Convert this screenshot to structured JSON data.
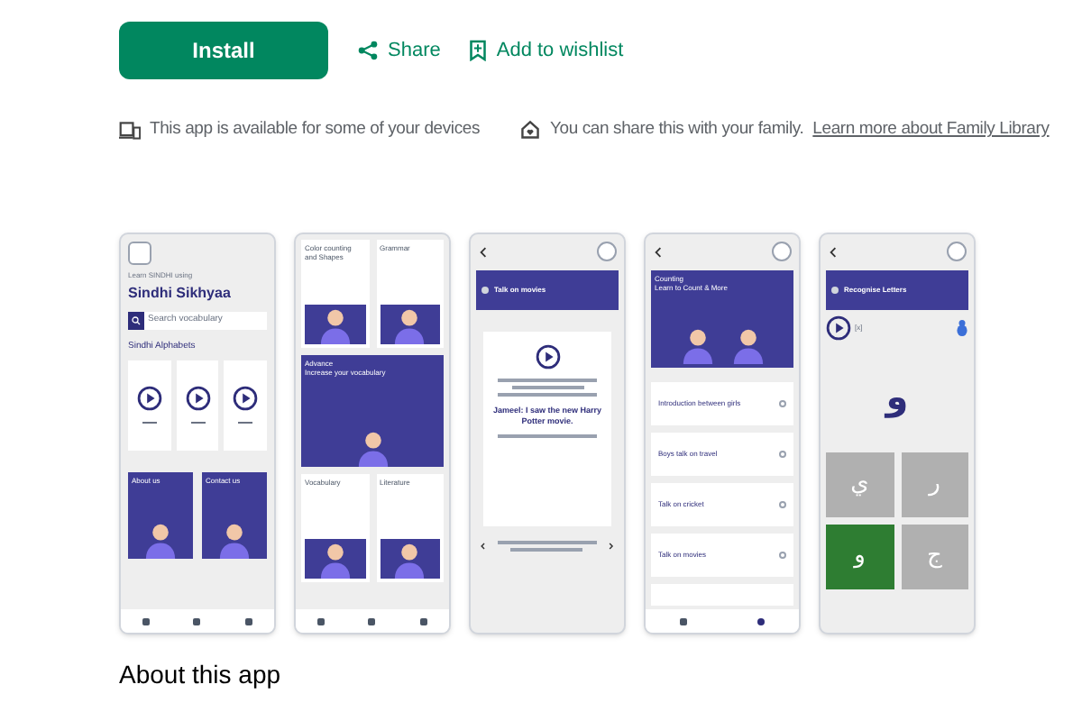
{
  "actions": {
    "install": "Install",
    "share": "Share",
    "wishlist": "Add to wishlist"
  },
  "notices": [
    {
      "kind": "devices",
      "text": "This app is available for some of your devices"
    },
    {
      "kind": "family",
      "text": "You can share this with your family.",
      "link": "Learn more about Family Library"
    }
  ],
  "screenshots": [
    {
      "kind": "home",
      "subtitle": "Learn SINDHI using",
      "title": "Sindhi Sikhyaa",
      "search_placeholder": "Search vocabulary",
      "section": "Sindhi Alphabets",
      "tiles": [
        "About us",
        "Contact us"
      ]
    },
    {
      "kind": "categories",
      "tiles": [
        {
          "label": "Color counting and Shapes",
          "wide": false
        },
        {
          "label": "Grammar",
          "wide": false
        },
        {
          "label": "Advance",
          "sub": "Increase your vocabulary",
          "wide": true
        },
        {
          "label": "Vocabulary",
          "wide": false
        },
        {
          "label": "Literature",
          "wide": false
        }
      ]
    },
    {
      "kind": "conversation",
      "title": "Talk on movies",
      "line": "Jameel: I saw the new Harry Potter movie."
    },
    {
      "kind": "lessons",
      "title": "Counting",
      "sub": "Learn to Count & More",
      "items": [
        "Introduction between girls",
        "Boys talk on travel",
        "Talk on cricket",
        "Talk on movies"
      ]
    },
    {
      "kind": "quiz",
      "title": "Recognise Letters",
      "hint": "[x]",
      "letter": "و",
      "options": [
        {
          "text": "ي",
          "selected": false
        },
        {
          "text": "ر",
          "selected": false
        },
        {
          "text": "و",
          "selected": true
        },
        {
          "text": "ج",
          "selected": false
        }
      ]
    }
  ],
  "section_heading": "About this app"
}
